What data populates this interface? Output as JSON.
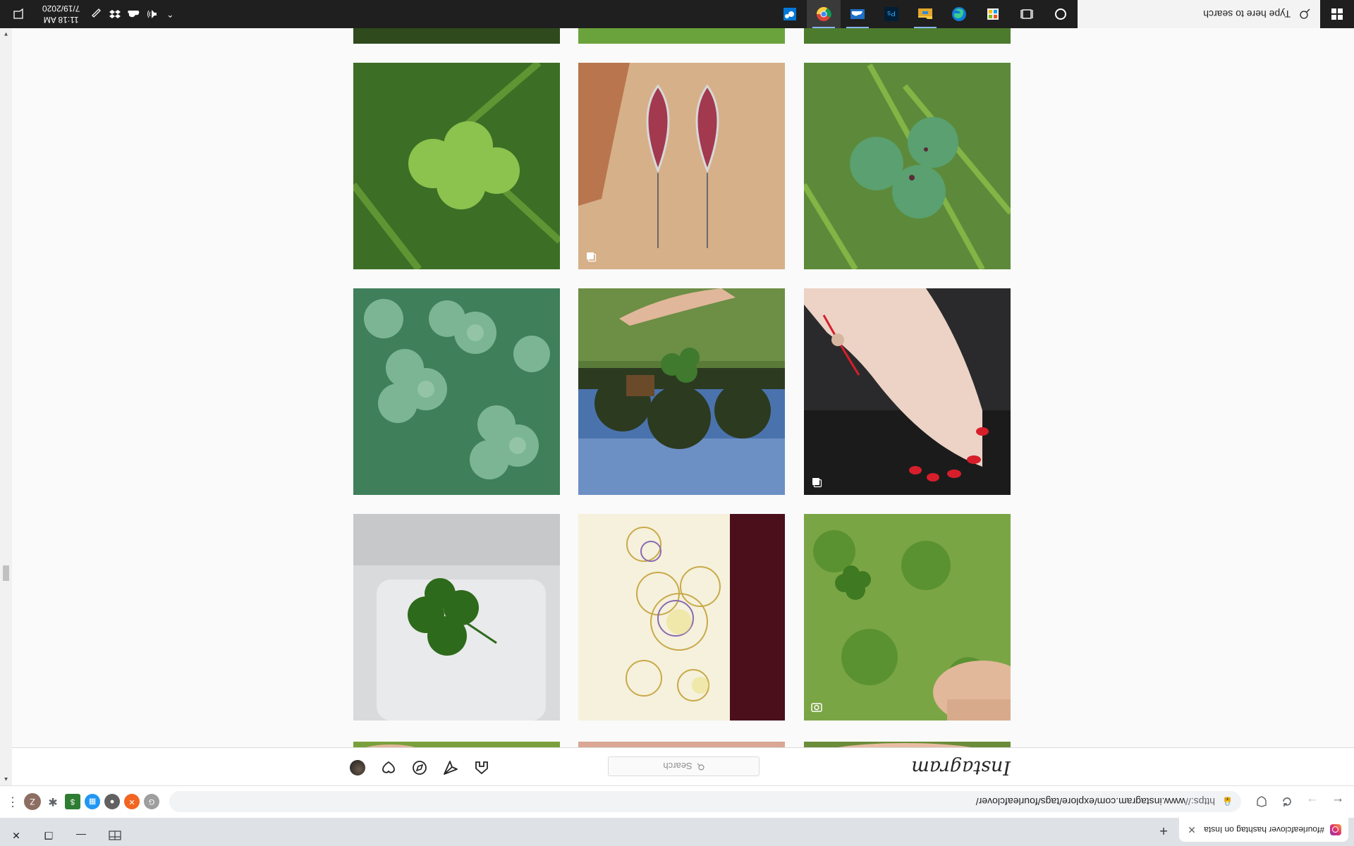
{
  "browser": {
    "tab_title": "#fourleafclover hashtag on Insta",
    "tab_close": "✕",
    "new_tab": "+",
    "window_minimize": "—",
    "window_restore": "❐",
    "window_close": "✕",
    "url_scheme": "https://",
    "url_rest": "www.instagram.com/explore/tags/fourleafclover/",
    "profile_initial": "Z",
    "menu": "⋮"
  },
  "instagram": {
    "logo": "Instagram",
    "search_placeholder": "Search",
    "nav_icons": [
      "home-icon",
      "direct-icon",
      "explore-icon",
      "activity-icon",
      "profile-avatar"
    ]
  },
  "posts": [
    {
      "subject": "four-leaf clover close-up",
      "multi": false
    },
    {
      "subject": "pressed rose petal resin earrings",
      "multi": true
    },
    {
      "subject": "three-leaf clover in grass",
      "multi": false
    },
    {
      "subject": "field of clovers",
      "multi": false
    },
    {
      "subject": "hand holding clover over lake",
      "multi": false
    },
    {
      "subject": "hand with red clover bracelet",
      "multi": true
    },
    {
      "subject": "four-leaf clover in white dish",
      "multi": false
    },
    {
      "subject": "clover flower painting",
      "multi": false
    },
    {
      "subject": "hand picking clover in grass",
      "multi": true,
      "camera": true
    },
    {
      "subject": "partial clover photo",
      "multi": false
    },
    {
      "subject": "partial hand photo",
      "multi": false
    },
    {
      "subject": "partial grass photo",
      "multi": false
    }
  ],
  "taskbar": {
    "search_placeholder": "Type here to search",
    "time": "11:18 AM",
    "date": "7/19/2020",
    "apps": [
      "cortana-icon",
      "task-view-icon",
      "store-icon",
      "edge-icon",
      "file-explorer-icon",
      "photoshop-icon",
      "onedrive-icon",
      "chrome-icon",
      "settings-icon"
    ],
    "photoshop_label": "Ps",
    "colors": {
      "taskbar": "#1f1f1f",
      "active_indicator": "#8ab4f8"
    }
  }
}
